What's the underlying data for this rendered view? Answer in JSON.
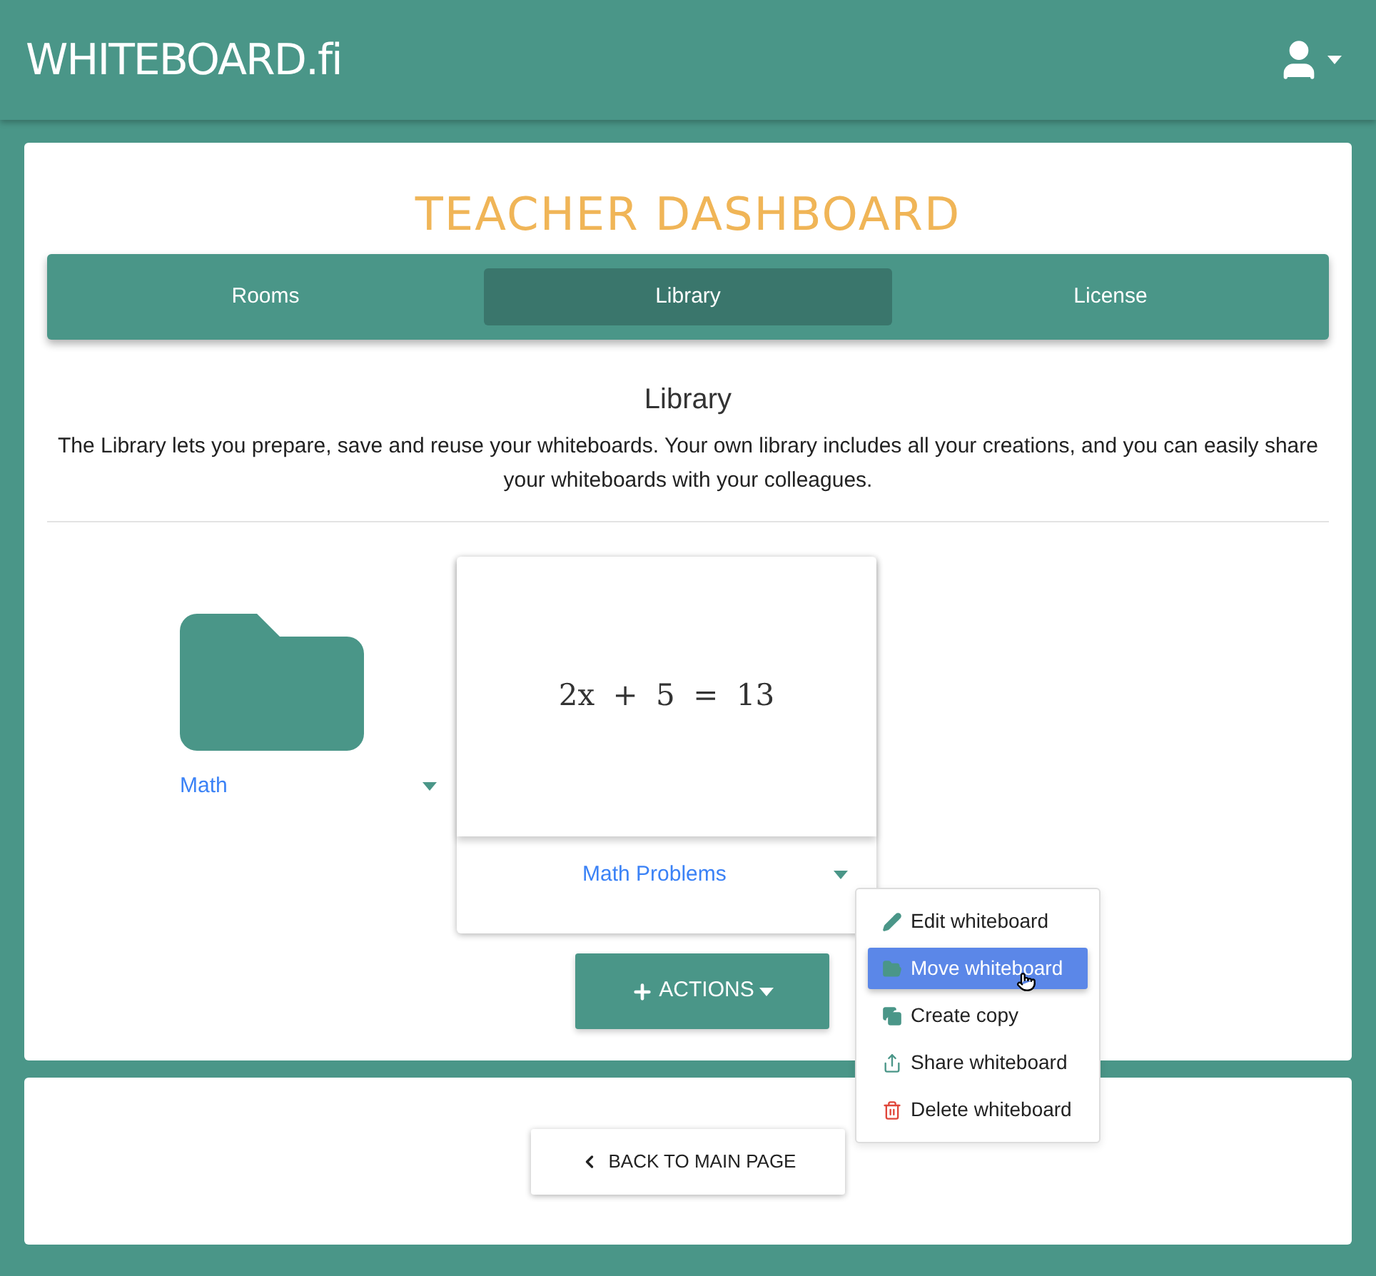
{
  "header": {
    "logo": "WHITEBOARD.fi"
  },
  "dashboard": {
    "title": "TEACHER DASHBOARD"
  },
  "tabs": [
    {
      "label": "Rooms",
      "selected": false
    },
    {
      "label": "Library",
      "selected": true
    },
    {
      "label": "License",
      "selected": false
    }
  ],
  "library": {
    "heading": "Library",
    "description": "The Library lets you prepare, save and reuse your whiteboards. Your own library includes all your creations, and you can easily share your whiteboards with your colleagues."
  },
  "items": [
    {
      "kind": "folder",
      "name": "Math"
    },
    {
      "kind": "whiteboard",
      "name": "Math Problems",
      "preview": "2x + 5 = 13",
      "menu_open": true
    }
  ],
  "menu": [
    {
      "kind": "edit",
      "label": "Edit whiteboard",
      "selected": false
    },
    {
      "kind": "move",
      "label": "Move whiteboard",
      "selected": true
    },
    {
      "kind": "copy",
      "label": "Create copy",
      "selected": false
    },
    {
      "kind": "share",
      "label": "Share whiteboard",
      "selected": false
    },
    {
      "kind": "delete",
      "label": "Delete whiteboard",
      "selected": false
    }
  ],
  "actions_button": {
    "label": "ACTIONS"
  },
  "back_button": {
    "label": "BACK TO MAIN PAGE"
  }
}
